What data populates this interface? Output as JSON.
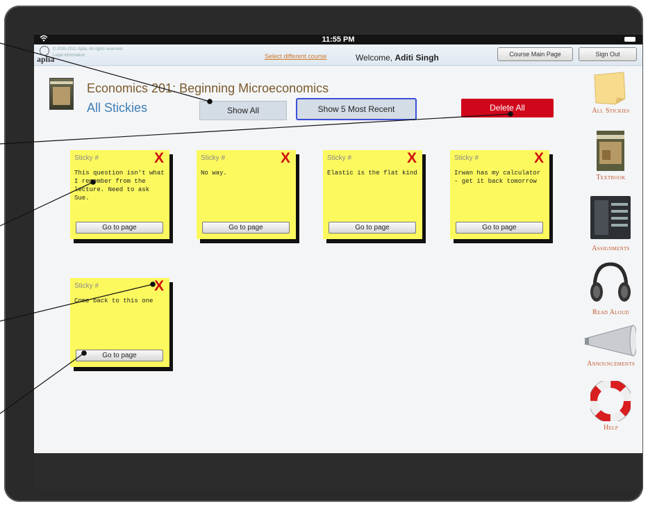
{
  "window": {
    "title": "Aplia - All Stickies"
  },
  "status_bar": {
    "time": "11:55 PM",
    "wifi_icon": "wifi-icon",
    "battery_icon": "battery-icon"
  },
  "header": {
    "logo": "aplia",
    "legal_line1": "© 2000-2011 Aplia. All rights reserved.",
    "legal_line2": "Legal information",
    "select_course": "Select different course",
    "welcome_prefix": "Welcome, ",
    "user_name": "Aditi Singh",
    "course_main_page": "Course Main Page",
    "sign_out": "Sign Out"
  },
  "course": {
    "title": "Economics 201: Beginning Microeconomics",
    "page_title": "All Stickies"
  },
  "toolbar": {
    "show_all": "Show All",
    "show_recent": "Show 5 Most Recent",
    "delete_all": "Delete All"
  },
  "stickies": [
    {
      "label": "Sticky #",
      "delete": "X",
      "note": "This question isn't what I remember from the lecture. Need to ask Sue.",
      "goto": "Go to page"
    },
    {
      "label": "Sticky #",
      "delete": "X",
      "note": "No way.",
      "goto": "Go to page"
    },
    {
      "label": "Sticky #",
      "delete": "X",
      "note": "Elastic is the flat kind",
      "goto": "Go to page"
    },
    {
      "label": "Sticky #",
      "delete": "X",
      "note": "Irwan has my calculator - get it back tomorrow",
      "goto": "Go to page"
    },
    {
      "label": "Sticky #",
      "delete": "X",
      "note": "Come back to this one",
      "goto": "Go to page"
    }
  ],
  "sidebar": {
    "items": [
      {
        "label": "All Stickies",
        "icon": "sticky-note-icon"
      },
      {
        "label": "Textbook",
        "icon": "textbook-icon"
      },
      {
        "label": "Assignments",
        "icon": "assignments-icon"
      },
      {
        "label": "Read Aloud",
        "icon": "headphones-icon"
      },
      {
        "label": "Announcements",
        "icon": "megaphone-icon"
      },
      {
        "label": "Help",
        "icon": "lifebuoy-icon"
      }
    ]
  },
  "colors": {
    "sticky": "#fcf95e",
    "delete": "#d0071a",
    "course_title": "#7b5a2c",
    "page_title": "#3e7fb6",
    "sidebar_caption": "#c0562a"
  }
}
